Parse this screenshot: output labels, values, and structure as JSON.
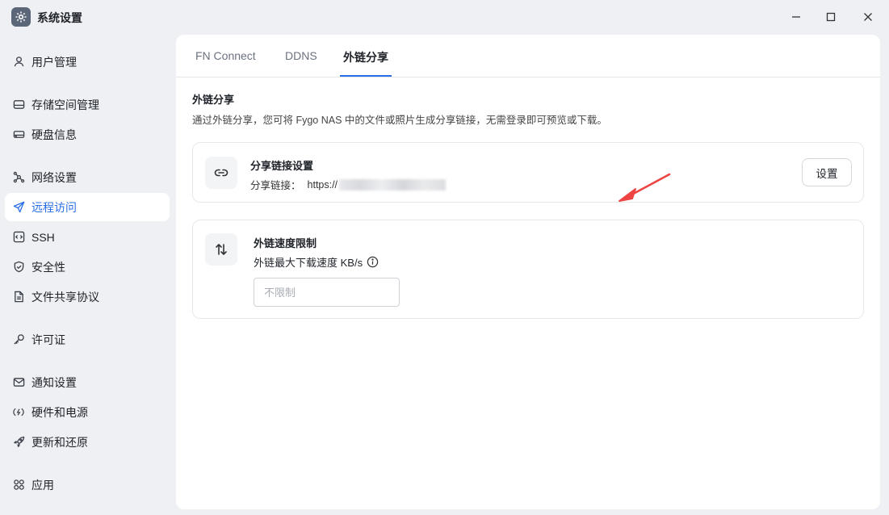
{
  "window": {
    "title": "系统设置"
  },
  "sidebar": {
    "items": [
      {
        "label": "用户管理",
        "icon": "user-icon"
      },
      {
        "label": "存储空间管理",
        "icon": "storage-icon"
      },
      {
        "label": "硬盘信息",
        "icon": "disk-icon"
      },
      {
        "label": "网络设置",
        "icon": "network-icon"
      },
      {
        "label": "远程访问",
        "icon": "send-icon",
        "active": true
      },
      {
        "label": "SSH",
        "icon": "code-icon"
      },
      {
        "label": "安全性",
        "icon": "shield-icon"
      },
      {
        "label": "文件共享协议",
        "icon": "document-icon"
      },
      {
        "label": "许可证",
        "icon": "key-icon"
      },
      {
        "label": "通知设置",
        "icon": "mail-icon"
      },
      {
        "label": "硬件和电源",
        "icon": "power-icon"
      },
      {
        "label": "更新和还原",
        "icon": "rocket-icon"
      },
      {
        "label": "应用",
        "icon": "apps-icon"
      }
    ]
  },
  "tabs": [
    {
      "label": "FN Connect"
    },
    {
      "label": "DDNS"
    },
    {
      "label": "外链分享",
      "active": true
    }
  ],
  "section": {
    "title": "外链分享",
    "description": "通过外链分享，您可将 Fygo NAS 中的文件或照片生成分享链接，无需登录即可预览或下载。"
  },
  "share_link_card": {
    "title": "分享链接设置",
    "link_label": "分享链接：",
    "link_value": "https://",
    "button_label": "设置",
    "icon": "link-icon"
  },
  "speed_card": {
    "title": "外链速度限制",
    "label": "外链最大下载速度 KB/s",
    "input_placeholder": "不限制",
    "input_value": "",
    "icon": "transfer-icon"
  },
  "colors": {
    "accent": "#2a6ee8",
    "annotation_arrow": "#ef4444"
  }
}
